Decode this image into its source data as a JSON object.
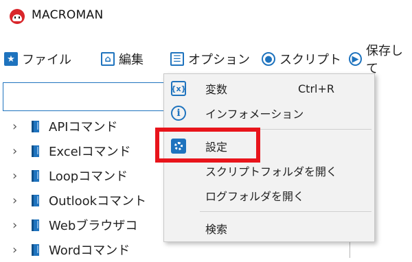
{
  "app": {
    "title": "MACROMAN"
  },
  "menubar": {
    "items": [
      {
        "label": "ファイル",
        "icon": "star-icon"
      },
      {
        "label": "編集",
        "icon": "home-icon"
      },
      {
        "label": "オプション",
        "icon": "list-icon"
      },
      {
        "label": "スクリプト",
        "icon": "record-icon"
      },
      {
        "label": "保存して",
        "icon": "play-icon"
      }
    ]
  },
  "tree": {
    "search_value": "",
    "items": [
      {
        "label": "APIコマンド"
      },
      {
        "label": "Excelコマンド"
      },
      {
        "label": "Loopコマンド"
      },
      {
        "label": "Outlookコマント"
      },
      {
        "label": "Webブラウザコ"
      },
      {
        "label": "Wordコマンド"
      }
    ]
  },
  "options_menu": {
    "items": [
      {
        "label": "変数",
        "shortcut": "Ctrl+R",
        "icon": "variable-icon"
      },
      {
        "label": "インフォメーション",
        "icon": "info-icon"
      },
      {
        "label": "設定",
        "icon": "gear-icon"
      },
      {
        "label": "スクリプトフォルダを開く"
      },
      {
        "label": "ログフォルダを開く"
      },
      {
        "label": "検索"
      }
    ]
  },
  "colors": {
    "accent": "#1e73be",
    "highlight": "#e8141b",
    "menu_bg": "#f2f2f2"
  }
}
